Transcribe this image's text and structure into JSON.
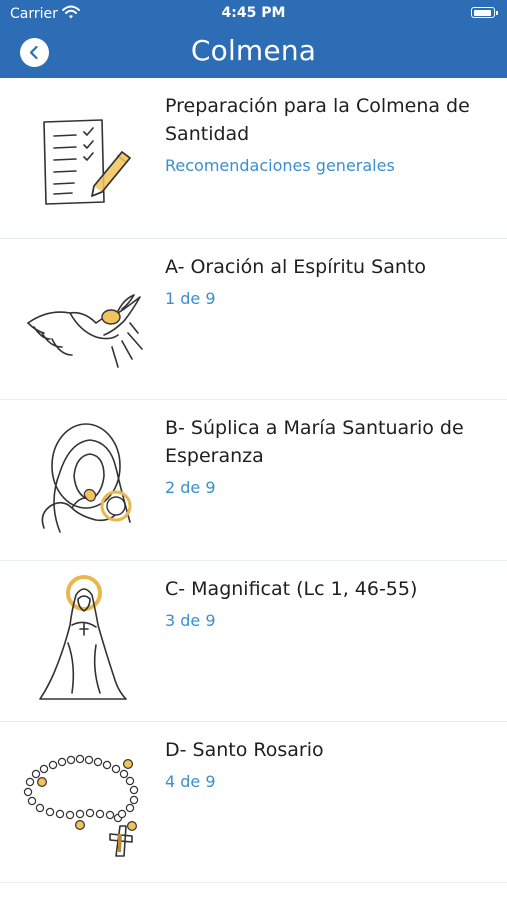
{
  "status_bar": {
    "carrier": "Carrier",
    "time": "4:45 PM"
  },
  "header": {
    "title": "Colmena",
    "back_icon": "chevron-left-icon"
  },
  "colors": {
    "header_bg": "#2c6db5",
    "accent": "#3b8fcf",
    "gold": "#e8b84a"
  },
  "items": [
    {
      "title": "Preparación para la Colmena de Santidad",
      "subtitle": "Recomendaciones generales",
      "icon": "checklist-pencil-icon"
    },
    {
      "title": "A- Oración al Espíritu Santo",
      "subtitle": "1 de 9",
      "icon": "dove-icon"
    },
    {
      "title": "B- Súplica a María Santuario de Esperanza",
      "subtitle": "2 de 9",
      "icon": "mary-child-icon"
    },
    {
      "title": "C- Magnificat (Lc 1, 46-55)",
      "subtitle": "3 de 9",
      "icon": "virgin-mary-icon"
    },
    {
      "title": "D- Santo Rosario",
      "subtitle": "4 de 9",
      "icon": "rosary-icon"
    }
  ]
}
